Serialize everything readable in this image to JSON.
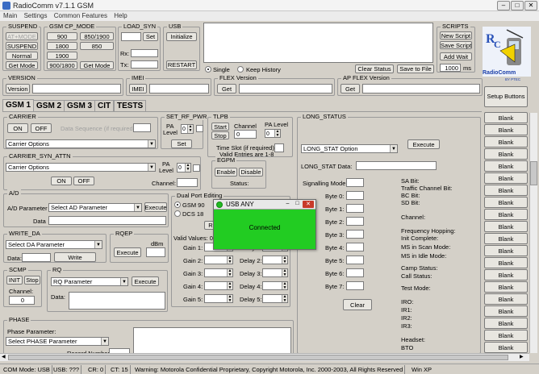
{
  "window": {
    "title": "RadioComm v7.1.1 GSM"
  },
  "menu": [
    "Main",
    "Settings",
    "Common Features",
    "Help"
  ],
  "suspend": {
    "legend": "SUSPEND",
    "at_mode": "AT+MODE",
    "suspend": "SUSPEND",
    "normal": "Normal",
    "get_mode": "Get Mode"
  },
  "cp_mode": {
    "legend": "GSM CP_MODE",
    "b900": "900",
    "b850_1900": "850/1900",
    "b1800": "1800",
    "b850": "850",
    "b1900": "1900",
    "b900_1800": "900/1800",
    "get_mode": "Get Mode"
  },
  "load_syn": {
    "legend": "LOAD_SYN",
    "set": "Set",
    "rx": "Rx:",
    "tx": "Tx:"
  },
  "usb": {
    "legend": "USB",
    "initialize": "Initialize",
    "restart": "RESTART"
  },
  "history": {
    "single": "Single",
    "keep": "Keep History",
    "clear_status": "Clear Status",
    "save_to_file": "Save to File"
  },
  "scripts": {
    "legend": "SCRIPTS",
    "new": "New Script",
    "save": "Save Script",
    "add_wait": "Add Wait",
    "wait_value": "1000",
    "wait_unit": "ms",
    "logo_text": "RadioComm",
    "logo_sub": "BY PTEC",
    "setup": "Setup Buttons"
  },
  "version": {
    "legend": "VERSION",
    "btn": "Version"
  },
  "imei": {
    "legend": "IMEI",
    "btn": "IMEI"
  },
  "flex": {
    "legend": "FLEX Version",
    "btn": "Get"
  },
  "apflex": {
    "legend": "AP FLEX Version",
    "btn": "Get"
  },
  "tabs": [
    "GSM 1",
    "GSM 2",
    "GSM 3",
    "CIT",
    "TESTS"
  ],
  "carrier": {
    "legend": "CARRIER",
    "on": "ON",
    "off": "OFF",
    "seq_label": "Data Sequence (if required)",
    "options": "Carrier Options"
  },
  "set_rf": {
    "legend": "SET_RF_PWR",
    "pa": "PA",
    "level": "Level",
    "value": "0",
    "set": "Set"
  },
  "tlpb": {
    "legend": "TLPB",
    "start": "Start",
    "stop": "Stop",
    "channel": "Channel",
    "ch_value": "0",
    "pa": "PA Level",
    "pa_value": "0",
    "timeslot": "Time Slot (if required)",
    "valid": "Valid Entries are 1-8"
  },
  "carrier_syn": {
    "legend": "CARRIER_SYN_ATTN",
    "options": "Carrier Options",
    "on": "ON",
    "off": "OFF",
    "pa": "PA",
    "level": "Level",
    "value": "0",
    "channel": "Channel:"
  },
  "egpm": {
    "legend": "EGPM",
    "enable": "Enable",
    "disable": "Disable",
    "status": "Status:"
  },
  "ad": {
    "legend": "A/D",
    "param_label": "A/D Parameter",
    "param": "Select AD Parameter",
    "execute": "Execute",
    "data": "Data"
  },
  "dual_port": {
    "legend": "Dual Port Editing",
    "gsm": "GSM 90",
    "dcs": "DCS 18",
    "re": "Re",
    "valid_values": "Valid Values: 0",
    "gains": [
      "Gain 1:",
      "Gain 2:",
      "Gain 3:",
      "Gain 4:",
      "Gain 5:"
    ],
    "delays": [
      "Delay 1:",
      "Delay 2:",
      "Delay 3:",
      "Delay 4:",
      "Delay 5:"
    ]
  },
  "write_da": {
    "legend": "WRITE_DA",
    "param": "Select DA Parameter",
    "data": "Data:",
    "write": "Write"
  },
  "rqep": {
    "legend": "RQEP",
    "execute": "Execute",
    "dbm": "dBm"
  },
  "scmp": {
    "legend": "SCMP",
    "init": "INIT",
    "stop": "Stop",
    "channel": "Channel:",
    "ch_value": "0"
  },
  "rq": {
    "legend": "RQ",
    "param": "RQ Parameter",
    "execute": "Execute",
    "data": "Data:"
  },
  "phase": {
    "legend": "PHASE",
    "param_label": "Phase Parameter:",
    "param": "Select PHASE Parameter",
    "record": "Record Number"
  },
  "long_status": {
    "legend": "LONG_STATUS",
    "option": "LONG_STAT Option",
    "execute": "Execute",
    "data_label": "LONG_STAT Data:",
    "signalling": "Signalling Mode:",
    "bytes": [
      "Byte 0:",
      "Byte 1:",
      "Byte 2:",
      "Byte 3:",
      "Byte 4:",
      "Byte 5:",
      "Byte 6:",
      "Byte 7:"
    ],
    "clear": "Clear",
    "info": [
      "SA Bit:",
      "Traffic Channel Bit:",
      "BC Bit:",
      "SD Bit:",
      "Channel:",
      "Frequency Hopping:",
      "Init Complete:",
      "MS in Scan Mode:",
      "MS in Idle Mode:",
      "Camp Status:",
      "Call Status:",
      "Test Mode:",
      "IRO:",
      "IR1:",
      "IR2:",
      "IR3:",
      "Headset:",
      "BTO"
    ]
  },
  "blank_buttons": [
    "Blank",
    "Blank",
    "Blank",
    "Blank",
    "Blank",
    "Blank",
    "Blank",
    "Blank",
    "Blank",
    "Blank",
    "Blank",
    "Blank",
    "Blank",
    "Blank",
    "Blank",
    "Blank",
    "Blank",
    "Blank",
    "Blank",
    "Blank"
  ],
  "usb_popup": {
    "title": "USB ANY",
    "message": "Connected"
  },
  "statusbar": {
    "com": "COM Mode: USB",
    "usb": "USB: ???",
    "cr": "CR: 0",
    "ct": "CT: 15",
    "warning": "Warning: Motorola Confidential Proprietary, Copyright Motorola, Inc. 2000-2003, All Rights Reserved",
    "os": "Win XP"
  },
  "colors": {
    "face": "#d4d0c8",
    "popup_green": "#22cc22",
    "popup_titlebar": "#e8e8e8"
  }
}
